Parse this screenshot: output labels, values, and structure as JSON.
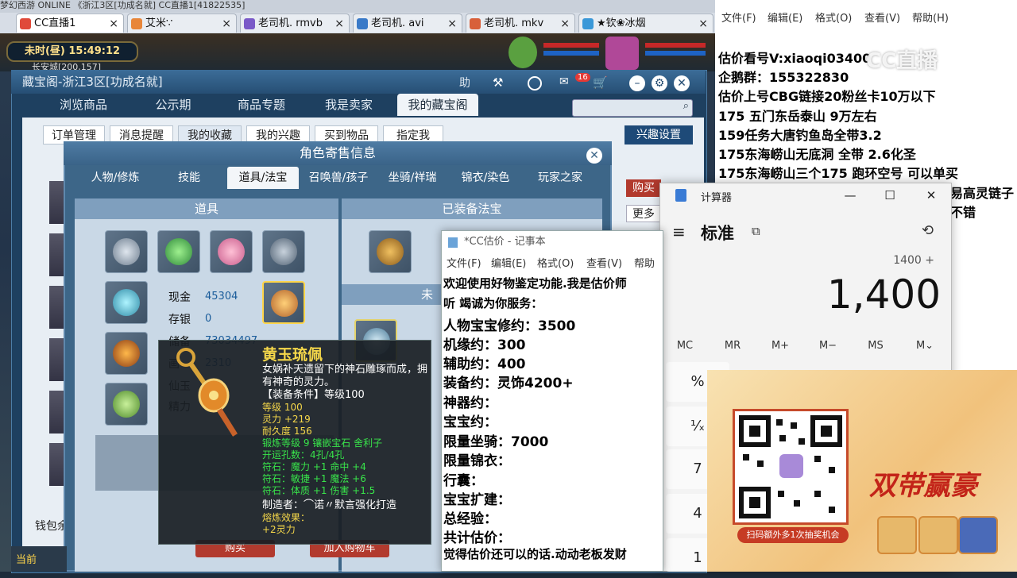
{
  "browser": {
    "top_strip": "梦幻西游 ONLINE    《浙江3区[功成名就]     CC直播1[41822535]",
    "tabs": [
      {
        "label": "CC直播1",
        "color": "#e04a3a"
      },
      {
        "label": "艾米∵",
        "color": "#e8863a"
      },
      {
        "label": "老司机. rmvb",
        "color": "#7a5ac8"
      },
      {
        "label": "老司机. avi",
        "color": "#3a7ac8"
      },
      {
        "label": "老司机. mkv",
        "color": "#d8603a"
      },
      {
        "label": "★钦❀冰烟",
        "color": "#3a98d8"
      }
    ]
  },
  "game": {
    "clock_period": "未时(昼)",
    "clock_time": "15:49:12",
    "location": "长安城[200,157]",
    "bottom_label": "当前"
  },
  "cbg": {
    "title": "藏宝阁-浙江3区[功成名就]",
    "toolbar_badge": "16",
    "nav": [
      "浏览商品",
      "公示期",
      "商品专题",
      "我是卖家",
      "我的藏宝阁"
    ],
    "subnav": [
      "订单管理",
      "消息提醒",
      "我的收藏",
      "我的兴趣",
      "买到物品",
      "指定我"
    ],
    "interest_button": "兴趣设置",
    "side_buy": "购买",
    "side_more": "更多",
    "wallet_label": "钱包余"
  },
  "dialog": {
    "title": "角色寄售信息",
    "tabs": [
      "人物/修炼",
      "技能",
      "道具/法宝",
      "召唤兽/孩子",
      "坐骑/祥瑞",
      "锦衣/染色",
      "玩家之家"
    ],
    "left_header": "道具",
    "right_header": "已装备法宝",
    "right_subheader": "未",
    "cash_label": "现金",
    "cash_value": "45304",
    "deposit_label": "存银",
    "deposit_value": "0",
    "reserve_label": "储备",
    "reserve_value": "73034497",
    "wood_label": "画",
    "wood_value": "2310",
    "xian_label": "仙玉",
    "jingli_label": "精力",
    "buy_button": "购买",
    "cart_button": "加入购物车"
  },
  "tooltip": {
    "name": "黄玉琉佩",
    "description": "女娲补天遗留下的神石雕琢而成，拥有神奇的灵力。",
    "requirement": "【装备条件】等级100",
    "green_lines": [
      "等级 100",
      "灵力 +219",
      "耐久度 156",
      "锻炼等级 9  镶嵌宝石 舍利子",
      "开运孔数：4孔/4孔",
      "符石：魔力 +1  命中 +4",
      "符石：敏捷 +1  魔法 +6",
      "符石：体质 +1  伤害 +1.5"
    ],
    "maker": "制造者：⌒诺〃默言强化打造",
    "melt_label": "熔炼效果：",
    "melt_value": "+2灵力"
  },
  "notepad_back": {
    "menu": [
      "文件(F)",
      "编辑(E)",
      "格式(O)",
      "查看(V)",
      "帮助(H)"
    ],
    "lines": [
      "估价看号V:xiaoqi03400",
      "企鹅群：155322830",
      "估价上号CBG链接20粉丝卡10万以下",
      "175 五门东岳泰山  9万左右",
      "159任务大唐钓鱼岛全带3.2",
      "175东海崂山无底洞  全带   2.6化圣",
      "175东海崂山三个175 跑环空号 可以单买",
      "易高灵链子",
      "不错"
    ]
  },
  "notepad_front": {
    "title": "*CC估价 - 记事本",
    "menu": [
      "文件(F)",
      "编辑(E)",
      "格式(O)",
      "查看(V)",
      "帮助"
    ],
    "lines": [
      "欢迎使用好物鉴定功能.我是估价师",
      "听 竭诚为你服务：",
      "人物宝宝修约：3500",
      "机缘约：300",
      "辅助约：400",
      "装备约：灵饰4200+",
      "神器约：",
      "宝宝约：",
      "限量坐骑：7000",
      "限量锦衣：",
      "行囊：",
      "宝宝扩建：",
      "总经验：",
      "共计估价：",
      "觉得估价还可以的话.动动老板发财"
    ]
  },
  "calculator": {
    "title": "计算器",
    "mode": "标准",
    "expression": "1400 +",
    "display": "1,400",
    "memory_buttons": [
      "MC",
      "MR",
      "M+",
      "M−",
      "MS",
      "M⌄"
    ],
    "keys": [
      "%",
      "¹⁄ₓ",
      "7",
      "4",
      "1"
    ]
  },
  "ad": {
    "title": "双带赢豪",
    "banner": "扫码额外多1次抽奖机会"
  },
  "watermark": "CC直播"
}
